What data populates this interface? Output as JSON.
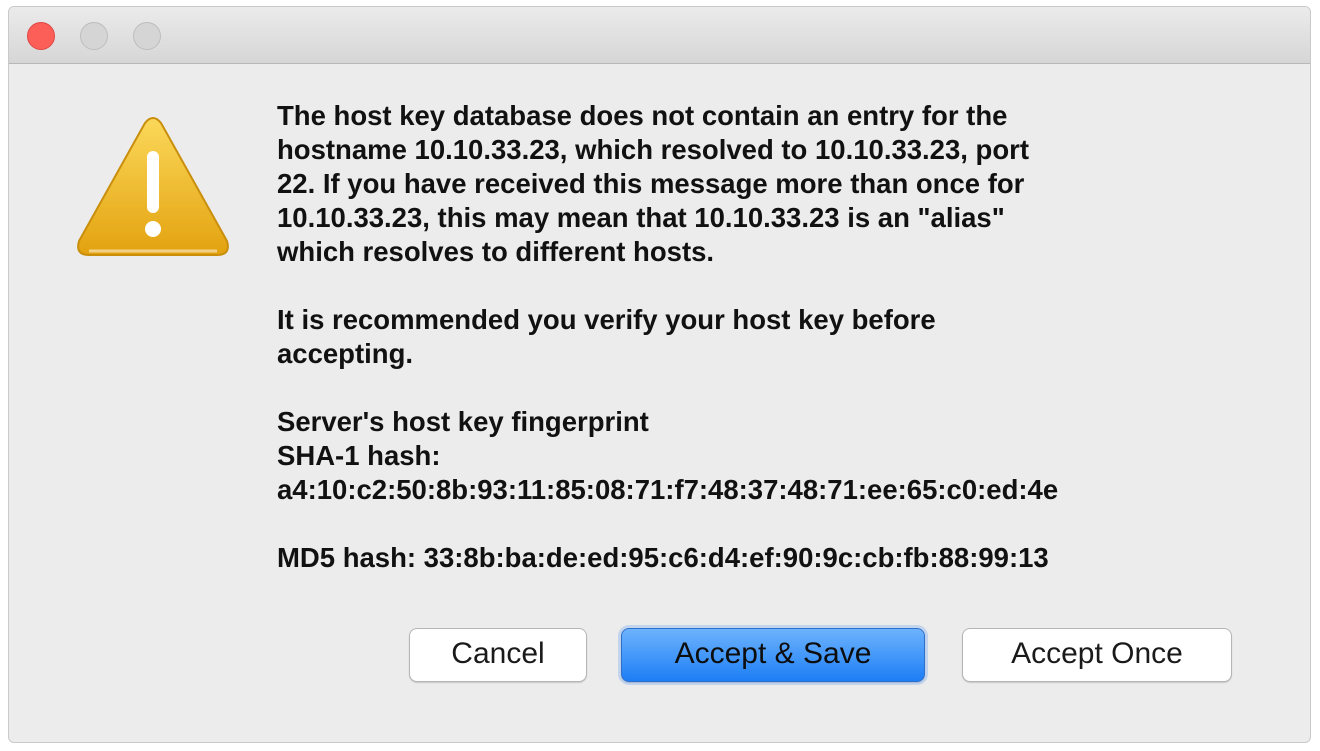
{
  "window": {
    "controls": [
      "close",
      "minimize",
      "zoom"
    ]
  },
  "icon": {
    "name": "warning-icon",
    "color": "#f2b61f"
  },
  "message": {
    "paragraph1": "The host key database does not contain an entry for the\nhostname 10.10.33.23, which resolved to 10.10.33.23, port\n22.  If you have received this message more than once for\n10.10.33.23, this may mean that 10.10.33.23 is an \"alias\"\nwhich resolves to different hosts.",
    "paragraph2_line1": "It is recommended you verify your host key before",
    "paragraph2_line2": "accepting.",
    "fingerprint_heading": "Server's host key fingerprint",
    "sha1_label": "SHA-1 hash:",
    "sha1_value": "a4:10:c2:50:8b:93:11:85:08:71:f7:48:37:48:71:ee:65:c0:ed:4e",
    "md5_line": "MD5 hash: 33:8b:ba:de:ed:95:c6:d4:ef:90:9c:cb:fb:88:99:13"
  },
  "buttons": {
    "cancel": "Cancel",
    "accept_save": "Accept & Save",
    "accept_once": "Accept Once"
  },
  "colors": {
    "primary_button": "#1d7ef5",
    "close_button": "#fc5f57"
  }
}
